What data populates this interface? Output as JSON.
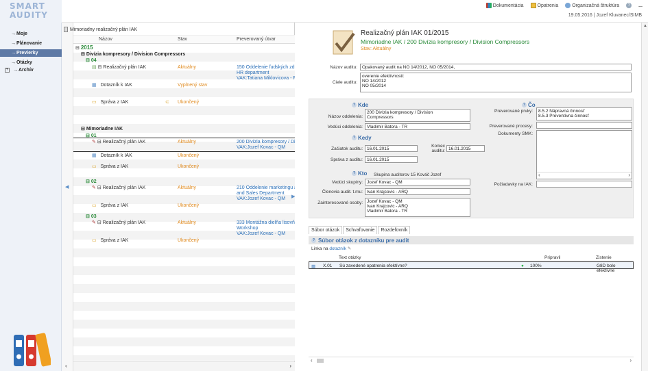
{
  "logo": {
    "line1": "SMART",
    "line2": "AUDITY"
  },
  "topmenu": {
    "docs": "Dokumentácia",
    "actions": "Opatrenia",
    "org": "Organizačná štruktúra",
    "help": "?",
    "more": "..."
  },
  "user_info": "19.05.2016 | Jozef Kluvanec/SIMB",
  "nav": [
    {
      "label": "Moje",
      "prefix": "→"
    },
    {
      "label": "Plánovanie",
      "prefix": "→"
    },
    {
      "label": "Previerky",
      "prefix": "→"
    },
    {
      "label": "Otázky",
      "prefix": "→"
    },
    {
      "label": "Archív",
      "prefix": "→"
    }
  ],
  "tree": {
    "title": "Mimoriadny realizačný plán IAK",
    "columns": {
      "name": "Názov",
      "state": "Stav",
      "unit": "Preverovaný útvar"
    },
    "year": "2015",
    "division": "Divízia kompresory / Division Compressors",
    "g04": "04",
    "row1": {
      "name": "Realizačný plán IAK",
      "state": "Aktuálny",
      "unit1": "150 Oddelenie ľudských zdr",
      "unit2": "HR department",
      "unit3": "VAK:Tatiana Miklovicova - F"
    },
    "row2": {
      "name": "Dotazník k IAK",
      "state": "Vyplnený stav"
    },
    "row3": {
      "name": "Správa z IAK",
      "state": "Ukončený"
    },
    "group2": "Mimoriadne IAK",
    "g01": "01",
    "row4": {
      "name": "Realizačný plán IAK",
      "state": "Aktuálny",
      "unit1": "200 Divízia kompresory / Di",
      "unit2": "VAK:Jozef Kovac - QM"
    },
    "row5": {
      "name": "Dotazník k IAK",
      "state": "Ukončený"
    },
    "row6": {
      "name": "Správa z IAK",
      "state": "Ukončený"
    },
    "g02": "02",
    "row7": {
      "name": "Realizačný plán IAK",
      "state": "Aktuálny",
      "unit1": "210 Oddelenie marketingu a",
      "unit2": "and Sales Department",
      "unit3": "VAK:Jozef Kovac - QM"
    },
    "row8": {
      "name": "Správa z IAK",
      "state": "Ukončený"
    },
    "g03": "03",
    "row9": {
      "name": "Realizačný plán IAK",
      "state": "Aktuálny",
      "unit1": "333 Montážna dielňa lisovňa",
      "unit2": "Workshop",
      "unit3": "VAK:Jozef Kovac - QM"
    },
    "row10": {
      "name": "Správa z IAK",
      "state": "Ukončený"
    }
  },
  "detail": {
    "title": "Realizačný plán IAK 01/2015",
    "subtitle": "Mimoriadne IAK / 200 Divízia kompresory / Division Compressors",
    "status": "Stav: Aktuálny",
    "audit_name_label": "Názov auditu:",
    "audit_name": "Opakovaný audit na NO 14/2012, NO 05/2014,",
    "goals_label": "Ciele auditu:",
    "goals": [
      "overenie efektívnosti:",
      "NO 14/2012",
      "NO 05/2014"
    ],
    "kde": "Kde",
    "dept_label": "Názov oddelenia:",
    "dept": [
      "200 Divízia kompresory / Division",
      "Compressors"
    ],
    "head_label": "Vedúci oddelenia:",
    "head": "Vladimír Batora - TR",
    "kedy": "Kedy",
    "start_label": "Začiatok auditu:",
    "start": "16.01.2015",
    "end_label1": "Koniec",
    "end_label2": "auditu:",
    "end": "16.01.2015",
    "report_label": "Správa z auditu:",
    "report": "16.01.2015",
    "kto": "Kto",
    "group_label": "Skupina auditorov 15 Kováč Jozef",
    "lead_label": "Vedúci skupiny:",
    "lead": "Jozef Kovac - QM",
    "members_label": "Členovia audit. t.mu:",
    "members": "Ivan Krajcovic - ARQ",
    "stake_label": "Zainteresované osoby:",
    "stake": [
      "Jozef Kovac - QM",
      "Ivan Krajcovic - ARQ",
      "Vladimír Batora - TR"
    ],
    "co": "Čo",
    "elements_label": "Preverované prvky:",
    "elements": [
      "8.5.2 Nápravná činnosť",
      "8.5.3 Preventívna činnosť"
    ],
    "processes_label": "Preverované procesy:",
    "smk_label": "Dokumenty SMK:",
    "req_label": "Požiadavky na IAK:",
    "tabs": [
      "Súbor otázok",
      "Schvaľovanie",
      "Rozdeľovník"
    ],
    "q_header": "Súbor otázok z dotazníku pre audit",
    "link_text": "Linka na",
    "link_anchor": "dotazník",
    "q_cols": {
      "text": "Text otázky",
      "prep": "Pripravil",
      "zist": "Zistenie"
    },
    "q_row": {
      "id": "X.01",
      "text": "Sú zavedené opatrenia efektívne?",
      "pct": "100%",
      "zist": "G8D bolo efektívne"
    }
  },
  "colors": {
    "accent": "#3a6ca8",
    "green": "#2b8b3a",
    "orange": "#e08a1e",
    "nav_active": "#5e7aa6"
  }
}
